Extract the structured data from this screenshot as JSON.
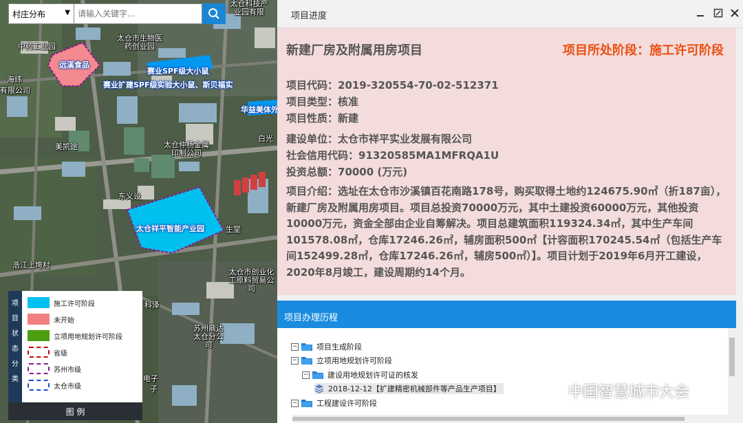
{
  "search": {
    "select_value": "村庄分布",
    "placeholder": "请输入关键字..."
  },
  "map_labels": {
    "company_a": "中药工业园",
    "company_b": "太仓市生物医药创业园",
    "company_c": "太仓科技产业园有限",
    "company_d": "海纬",
    "company_e": "有限公司",
    "company_f": "美凯途",
    "company_g": "太仓仲杨金属印制公司",
    "company_h": "白光",
    "company_i": "东义设",
    "company_j": "生堂",
    "company_k": "浩江上垮村",
    "company_l": "太仓市创业化工原料贸易公司",
    "company_m": "科泽",
    "company_n": "苏州鼎达太仓分公司",
    "company_o": "电子",
    "company_p": "子"
  },
  "poi_labels": {
    "yuanxi": "远溪食品",
    "saiye1": "赛业SPF级大小鼠",
    "saiye2": "赛业扩建SPF级实验大小鼠、斯贝福实",
    "huayi": "华益美体外",
    "xiangping": "太仓祥平智能产业园"
  },
  "legend": {
    "side_chars": [
      "项",
      "目",
      "状",
      "态",
      "分",
      "类"
    ],
    "items": [
      {
        "label": "施工许可阶段",
        "color": "#00c0f0"
      },
      {
        "label": "未开始",
        "color": "#f28080"
      },
      {
        "label": "立项用地规划许可阶段",
        "color": "#4a9e10"
      },
      {
        "label": "省级",
        "color": "#cc0000"
      },
      {
        "label": "苏州市级",
        "color": "#8a1a8a"
      },
      {
        "label": "太仓市级",
        "color": "#1a4ad8"
      }
    ],
    "footer": "图 例"
  },
  "panel": {
    "title": "项目进度",
    "project_name": "新建厂房及附属用房项目",
    "stage": "项目所处阶段：施工许可阶段",
    "fields": {
      "code": "项目代码：2019-320554-70-02-512371",
      "type": "项目类型：核准",
      "nature": "项目性质：新建",
      "builder": "建设单位：太仓市祥平实业发展有限公司",
      "credit": "社会信用代码：91320585MA1MFRQA1U",
      "investment": "投资总额：70000 (万元)"
    },
    "intro": "项目介绍：选址在太仓市沙溪镇百花南路178号，购买取得土地约124675.90㎡（折187亩），新建厂房及附属用房项目。项目总投资70000万元，其中土建投资60000万元，其他投资10000万元，资金全部由企业自筹解决。项目总建筑面积119324.34㎡，其中生产车间101578.08㎡，仓库17246.26㎡，辅房面积500㎡【计容面积170245.54㎡（包括生产车间152499.28㎡，仓库17246.26㎡，辅房500㎡）】。项目计划于2019年6月开工建设，2020年8月竣工，建设周期约14个月。"
  },
  "history": {
    "title": "项目办理历程",
    "nodes": {
      "n1": "项目生成阶段",
      "n2": "立项用地规划许可阶段",
      "n3": "建设用地规划许可证的核发",
      "n4": "2018-12-12【扩建精密机械部件等产品生产项目】",
      "n5": "工程建设许可阶段"
    }
  },
  "watermark": "中国智慧城市大会"
}
